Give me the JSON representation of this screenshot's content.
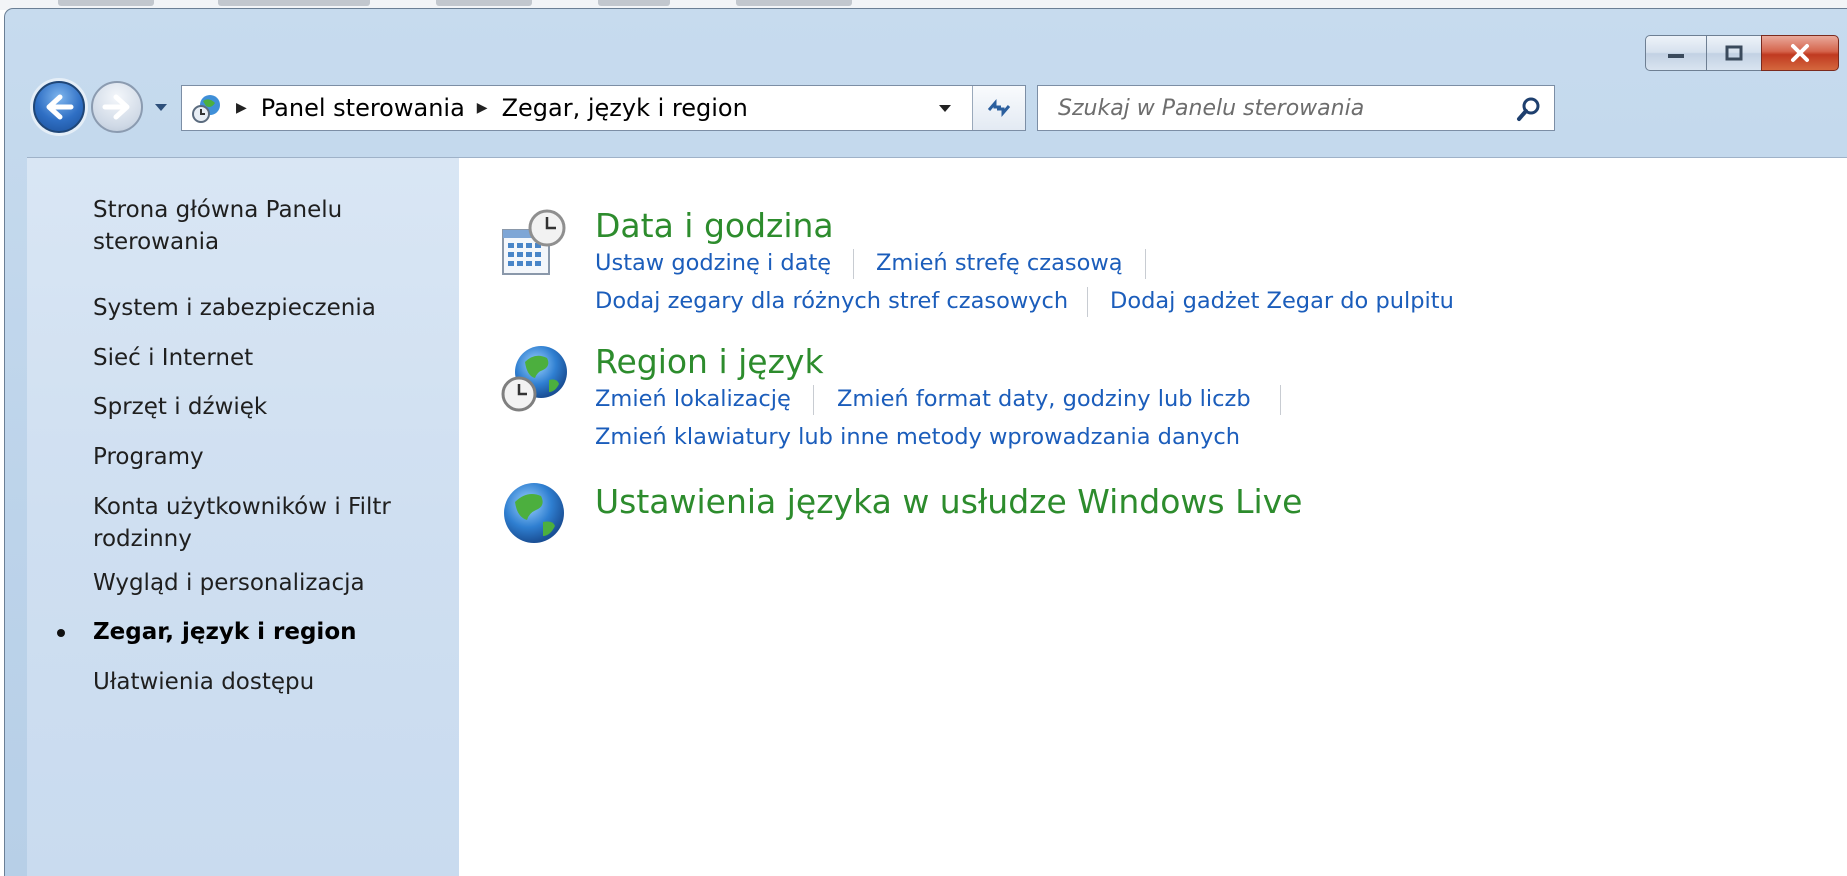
{
  "window": {
    "caption": {
      "minimize": "minimize",
      "maximize": "maximize",
      "close": "close"
    }
  },
  "navbar": {
    "breadcrumb": [
      "Panel sterowania",
      "Zegar, język i region"
    ],
    "search_placeholder": "Szukaj w Panelu sterowania"
  },
  "sidebar": {
    "items": [
      {
        "label": "Strona główna Panelu sterowania",
        "active": false
      },
      {
        "label": "System i zabezpieczenia",
        "active": false
      },
      {
        "label": "Sieć i Internet",
        "active": false
      },
      {
        "label": "Sprzęt i dźwięk",
        "active": false
      },
      {
        "label": "Programy",
        "active": false
      },
      {
        "label": "Konta użytkowników i Filtr rodzinny",
        "active": false
      },
      {
        "label": "Wygląd i personalizacja",
        "active": false
      },
      {
        "label": "Zegar, język i region",
        "active": true
      },
      {
        "label": "Ułatwienia dostępu",
        "active": false
      }
    ]
  },
  "categories": [
    {
      "title": "Data i godzina",
      "icon": "calendar-clock-icon",
      "links": [
        "Ustaw godzinę i datę",
        "Zmień strefę czasową",
        "Dodaj zegary dla różnych stref czasowych",
        "Dodaj gadżet Zegar do pulpitu"
      ]
    },
    {
      "title": "Region i język",
      "icon": "globe-clock-icon",
      "links": [
        "Zmień lokalizację",
        "Zmień format daty, godziny lub liczb",
        "Zmień klawiatury lub inne metody wprowadzania danych"
      ]
    },
    {
      "title": "Ustawienia języka w usłudze Windows Live",
      "icon": "globe-icon",
      "links": []
    }
  ],
  "colors": {
    "category_title": "#2d8c2d",
    "link": "#1b5dbb",
    "sidebar_bg": "#d3e2f2",
    "chrome_bg": "#bcd3ea",
    "close_button": "#c94a2e"
  }
}
